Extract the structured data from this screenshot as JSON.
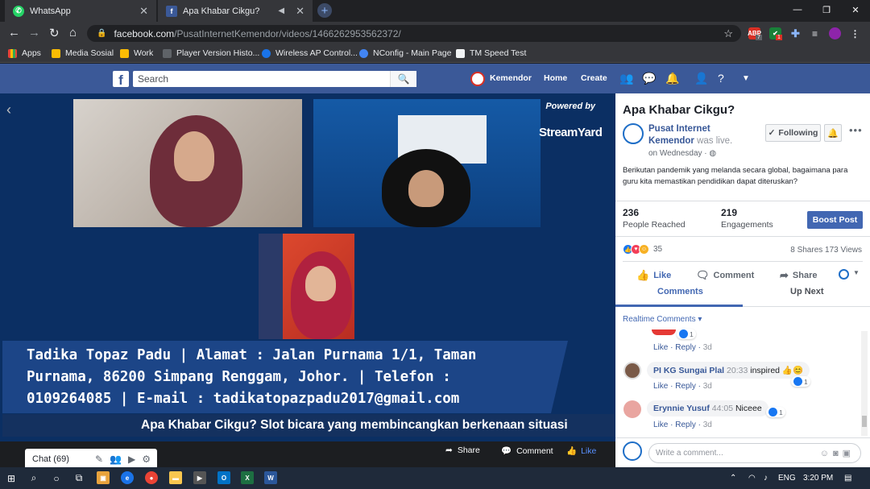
{
  "browser": {
    "tabs": [
      {
        "label": "WhatsApp",
        "icon": "whatsapp-icon"
      },
      {
        "label": "Apa Khabar Cikgu?",
        "icon": "facebook-icon"
      }
    ],
    "url_host": "facebook.com",
    "url_path": "/PusatInternetKemendor/videos/1466262953562372/",
    "ext_badges": [
      "7",
      "1"
    ],
    "bookmarks": [
      "Apps",
      "Media Sosial",
      "Work",
      "Player Version Histo...",
      "Wireless AP Control...",
      "NConfig - Main Page",
      "TM Speed Test"
    ]
  },
  "fb_nav": {
    "search_placeholder": "Search",
    "profile": "Kemendor",
    "home": "Home",
    "create": "Create"
  },
  "video": {
    "powered_by": "Powered by",
    "streamyard": "StreamYard",
    "banner_lines": [
      "Tadika Topaz Padu | Alamat : Jalan Purnama 1/1, Taman",
      "Purnama, 86200 Simpang Renggam, Johor. | Telefon :",
      "0109264085 | E-mail : tadikatopazpadu2017@gmail.com"
    ],
    "ticker": "Apa Khabar Cikgu? Slot bicara yang membincangkan berkenaan situasi",
    "share": "Share",
    "comment": "Comment",
    "like": "Like",
    "chat": "Chat (69)"
  },
  "post": {
    "title": "Apa Khabar Cikgu?",
    "page_name_1": "Pusat Internet",
    "page_name_2": "Kemendor",
    "was_live": " was live.",
    "date": "on Wednesday · ",
    "following": "Following",
    "description": "Berikutan pandemik yang melanda secara global, bagaimana para guru kita memastikan pendidikan dapat diteruskan?",
    "people_reached_num": "236",
    "people_reached_label": "People Reached",
    "engagements_num": "219",
    "engagements_label": "Engagements",
    "boost": "Boost Post",
    "reactions_count": "35",
    "shares_views": "8 Shares  173 Views",
    "action_like": "Like",
    "action_comment": "Comment",
    "action_share": "Share",
    "tab_comments": "Comments",
    "tab_upnext": "Up Next",
    "realtime": "Realtime Comments ▾"
  },
  "comments": [
    {
      "name": "",
      "text": "",
      "time": "3d",
      "likes": "1"
    },
    {
      "name": "PI KG Sungai Plal",
      "time_stamp": "20:33",
      "text": "inspired 👍😊",
      "time": "3d",
      "likes": "1"
    },
    {
      "name": "Erynnie Yusuf",
      "time_stamp": "44:05",
      "text": "Niceee",
      "time": "3d",
      "likes": "1"
    }
  ],
  "comment_actions": {
    "like": "Like",
    "reply": "Reply"
  },
  "write_comment": "Write a comment...",
  "taskbar": {
    "lang": "ENG",
    "time": "3:20 PM"
  },
  "colors": {
    "fb_blue": "#3b5998",
    "boost": "#4267b2",
    "chrome_dark": "#202124"
  }
}
